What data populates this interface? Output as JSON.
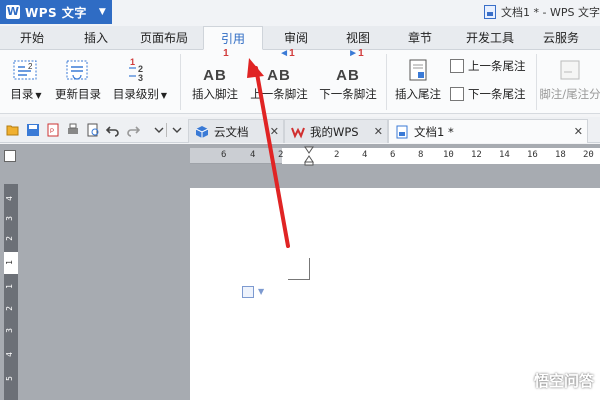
{
  "app": {
    "name": "WPS 文字",
    "logo": "W"
  },
  "window": {
    "title": "文档1 * - WPS 文字"
  },
  "menu": [
    {
      "label": "开始"
    },
    {
      "label": "插入"
    },
    {
      "label": "页面布局"
    },
    {
      "label": "引用",
      "active": true
    },
    {
      "label": "审阅"
    },
    {
      "label": "视图"
    },
    {
      "label": "章节"
    },
    {
      "label": "开发工具"
    },
    {
      "label": "云服务"
    }
  ],
  "ribbon": {
    "toc": "目录",
    "update_toc": "更新目录",
    "toc_level": "目录级别",
    "insert_footnote": "插入脚注",
    "prev_footnote": "上一条脚注",
    "next_footnote": "下一条脚注",
    "insert_endnote": "插入尾注",
    "prev_endnote": "上一条尾注",
    "next_endnote": "下一条尾注",
    "footnote_endnote": "脚注/尾注分",
    "ab": "AB",
    "num1": "1",
    "num2": "2",
    "num3": "3"
  },
  "doc_tabs": [
    {
      "label": "云文档"
    },
    {
      "label": "我的WPS"
    },
    {
      "label": "文档1 *",
      "active": true
    }
  ],
  "ruler": {
    "h_numbers": [
      "6",
      "4",
      "2",
      "2",
      "4",
      "6",
      "8",
      "10",
      "12",
      "14",
      "16",
      "18",
      "20"
    ],
    "v_numbers": [
      "4",
      "3",
      "2",
      "1",
      "1",
      "2",
      "3",
      "4",
      "5"
    ]
  },
  "watermark": "悟空问答",
  "colors": {
    "accent": "#2f6cc4",
    "arrow": "#e02424",
    "workspace": "#a7abb1"
  }
}
